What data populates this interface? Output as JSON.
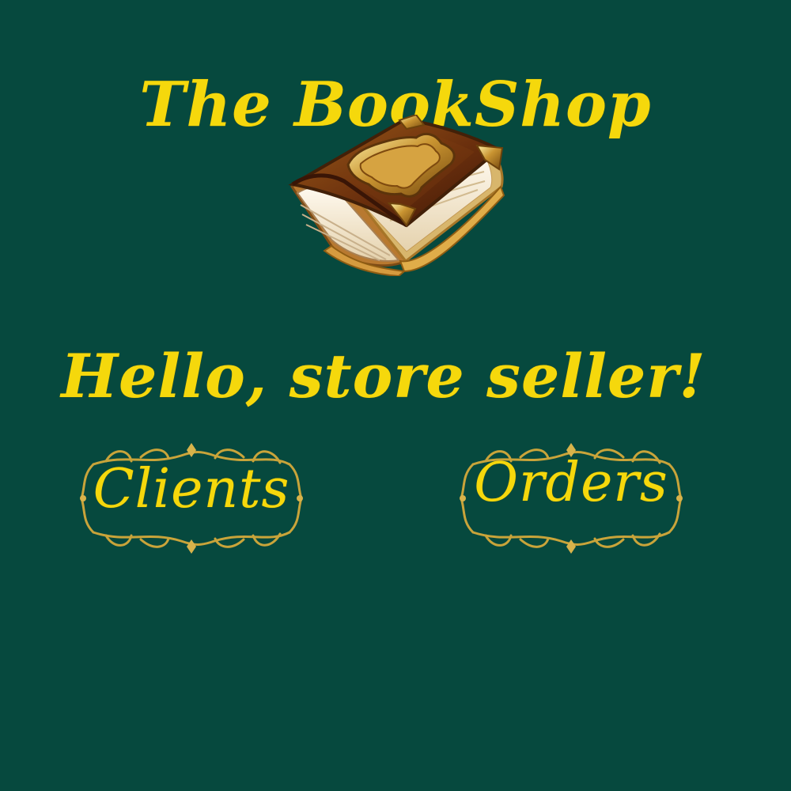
{
  "app": {
    "title": "The BookShop",
    "greeting": "Hello, store seller!"
  },
  "nav": {
    "clients_label": "Clients",
    "orders_label": "Orders"
  },
  "icons": {
    "logo": "book-icon",
    "button_frame": "ornate-gold-frame"
  },
  "colors": {
    "background": "#06493e",
    "text": "#f5d80c",
    "ornament_gold": "#c9a43a"
  }
}
